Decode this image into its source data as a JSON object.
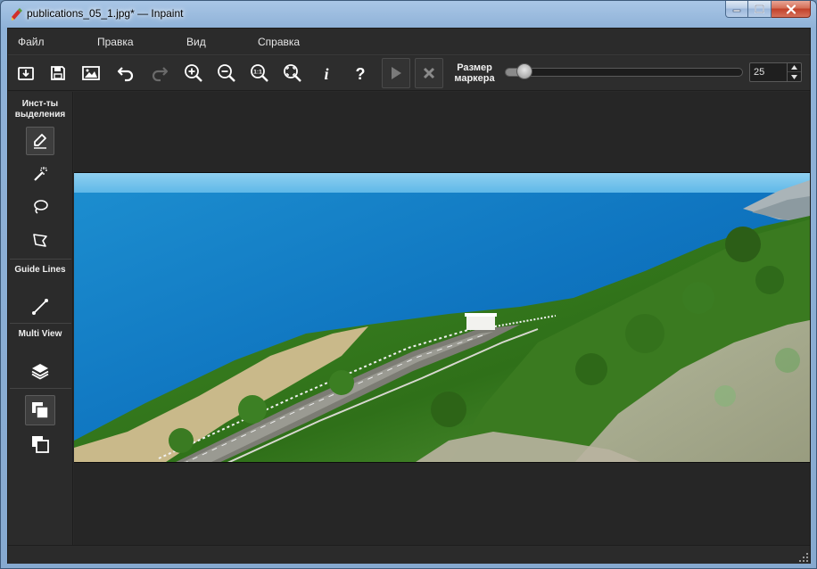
{
  "window": {
    "title": "publications_05_1.jpg* — Inpaint"
  },
  "menu": {
    "items": [
      "Файл",
      "Правка",
      "Вид",
      "Справка"
    ]
  },
  "toolbar": {
    "buttons": [
      "open-icon",
      "save-icon",
      "image-icon",
      "undo-icon",
      "redo-icon",
      "zoom-in-icon",
      "zoom-out-icon",
      "zoom-actual-icon",
      "zoom-fit-icon",
      "info-icon",
      "help-icon",
      "run-icon",
      "cancel-icon"
    ],
    "marker_label": "Размер маркера",
    "marker_value": "25",
    "marker_fraction": 0.05
  },
  "left_panel": {
    "selection_title": "Инст-ты выделения",
    "guide_title": "Guide Lines",
    "multi_title": "Multi View"
  },
  "colors": {
    "dark_bg": "#2a2a2a",
    "panel_bg": "#2b2b2b",
    "accent_text": "#f0f0f0"
  }
}
